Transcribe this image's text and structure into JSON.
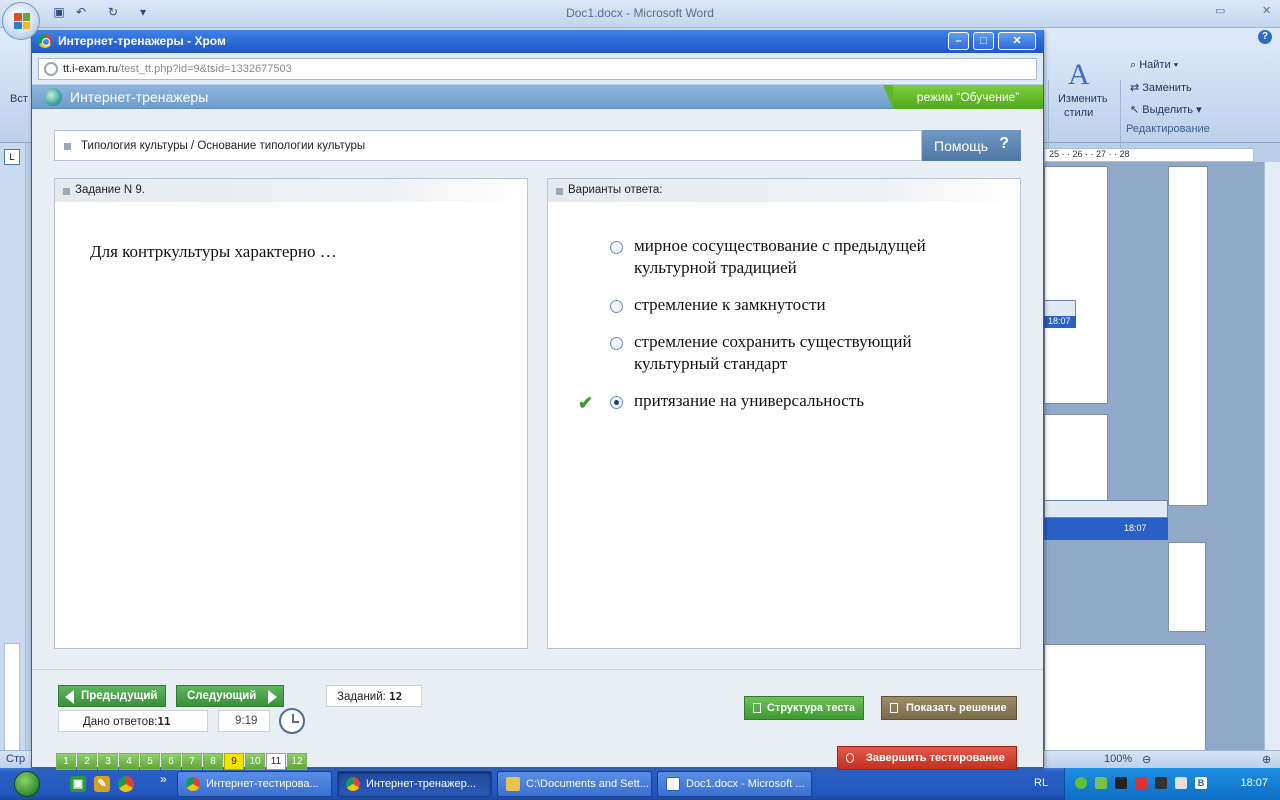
{
  "word": {
    "doc_title": "Doc1.docx - Microsoft Word",
    "ribbon": {
      "paste_label": "Вст",
      "change_styles": [
        "Изменить",
        "стили"
      ],
      "find": "Найти",
      "replace": "Заменить",
      "select": "Выделить",
      "group_editing": "Редактирование"
    },
    "ruler_text": "25 · · 26 · · 27 · · 28",
    "status_left": "Стр",
    "zoom": "100%",
    "nested_clock": "18:07"
  },
  "browser": {
    "title": "Интернет-тренажеры - Хром",
    "url_host": "tt.i-exam.ru",
    "url_path": "/test_tt.php?id=9&tsid=1332677503"
  },
  "app": {
    "name": "Интернет-тренажеры",
    "mode": "режим “Обучение”",
    "breadcrumb": "Типология культуры / Основание типологии культуры",
    "help_label": "Помощь",
    "help_symbol": "?",
    "task_header": "Задание N 9.",
    "question": "Для контркультуры характерно …",
    "answers_header": "Варианты ответа:",
    "answers": [
      {
        "text": "мирное сосуществование с предыдущей культурной традицией",
        "selected": false
      },
      {
        "text": "стремление к замкнутости",
        "selected": false
      },
      {
        "text": "стремление сохранить существующий культурный стандарт",
        "selected": false
      },
      {
        "text": "притязание на универсальность",
        "selected": true
      }
    ],
    "check_mark": "✔",
    "prev_label": "Предыдущий",
    "next_label": "Следующий",
    "tasks_label": "Заданий:",
    "tasks_count": "12",
    "answered_label": "Дано ответов:",
    "answered_count": "11",
    "timer": "9:19",
    "pages": [
      "1",
      "2",
      "3",
      "4",
      "5",
      "6",
      "7",
      "8",
      "9",
      "10",
      "11",
      "12"
    ],
    "current_page": "9",
    "structure_label": "Структура теста",
    "solution_label": "Показать решение",
    "finish_label": "Завершить тестирование"
  },
  "taskbar": {
    "more": "»",
    "buttons": [
      {
        "label": "Интернет-тестирова..."
      },
      {
        "label": "Интернет-тренажер..."
      },
      {
        "label": "C:\\Documents and Sett..."
      },
      {
        "label": "Doc1.docx - Microsoft ..."
      }
    ],
    "lang": "RL",
    "clock": "18:07"
  },
  "colors": {
    "accent_green": "#4fa81e",
    "header_blue": "#6e9cc9",
    "current_page_yellow": "#f2e400",
    "finish_red": "#c33020"
  }
}
